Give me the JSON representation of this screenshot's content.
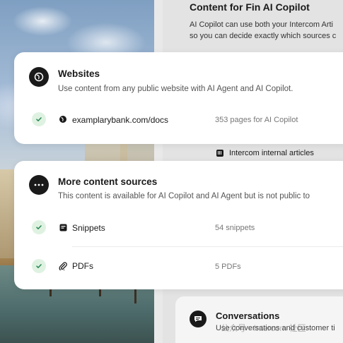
{
  "back": {
    "title": "Content for Fin AI Copilot",
    "desc_line1": "AI Copilot can use both your Intercom Arti",
    "desc_line2": "so you can decide exactly which sources c",
    "internal_articles": "Intercom internal articles",
    "conversations_title": "Conversations",
    "conversations_desc": "Use conversations and customer ti",
    "watermark": "公众号 · Intercom 社区"
  },
  "websites": {
    "title": "Websites",
    "desc": "Use content from any public website with AI Agent and AI Copilot.",
    "rows": [
      {
        "label": "examplarybank.com/docs",
        "meta": "353 pages for AI Copilot"
      }
    ]
  },
  "more": {
    "title": "More content sources",
    "desc": "This content is available for AI Copilot and AI Agent but is not public to",
    "rows": [
      {
        "label": "Snippets",
        "meta": "54 snippets"
      },
      {
        "label": "PDFs",
        "meta": "5 PDFs"
      }
    ]
  },
  "colors": {
    "accent_dark": "#1a1a1a",
    "check_bg": "#dff2e2",
    "check_mark": "#2e8b57"
  }
}
